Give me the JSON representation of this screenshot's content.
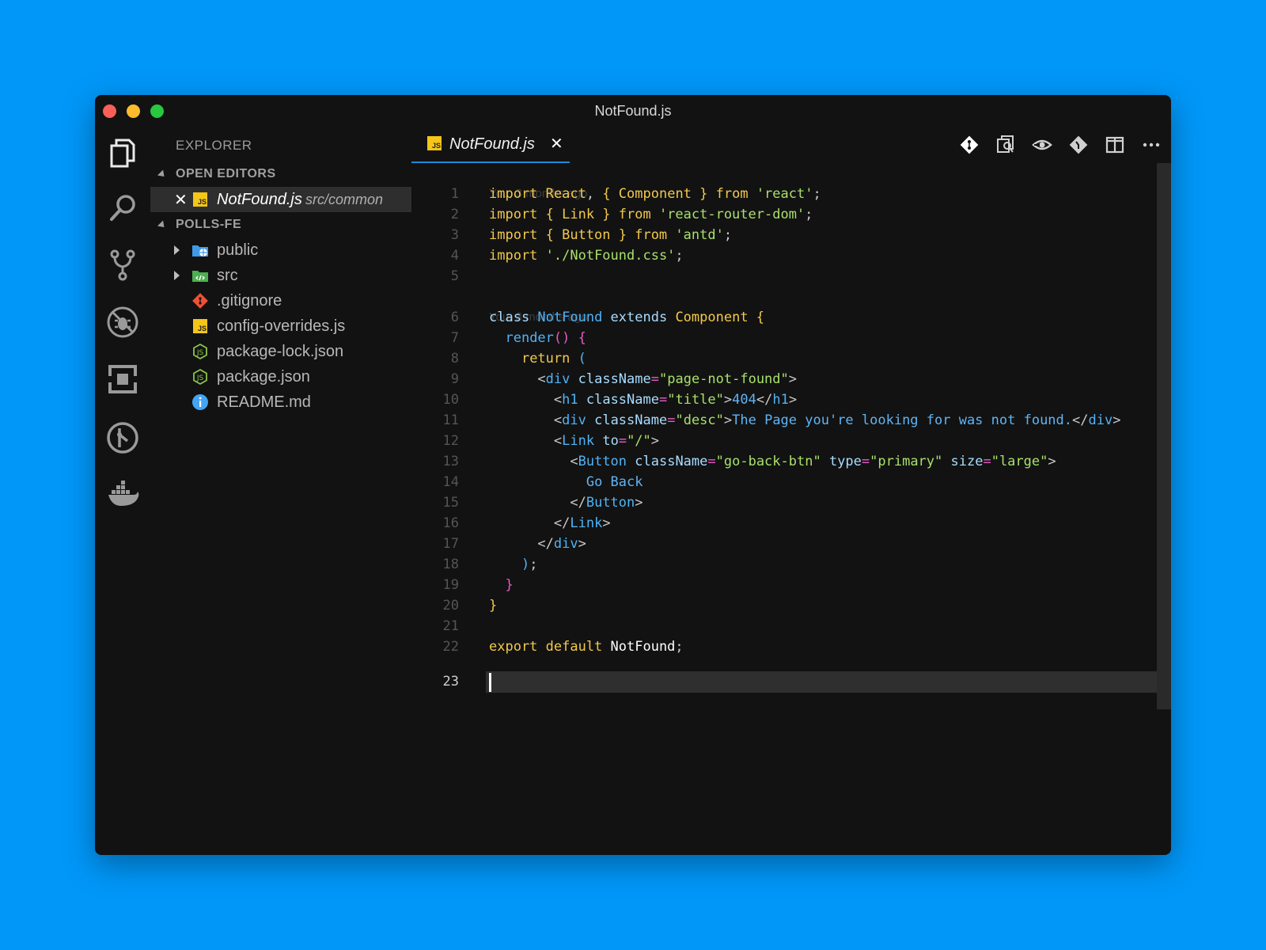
{
  "window": {
    "title": "NotFound.js"
  },
  "sidebar": {
    "title": "EXPLORER",
    "open_editors_label": "OPEN EDITORS",
    "open_editor": {
      "name": "NotFound.js",
      "path": "src/common",
      "close": "✕"
    },
    "project_label": "POLLS-FE",
    "tree": [
      {
        "name": "public",
        "icon": "folder-public-icon",
        "folder": true
      },
      {
        "name": "src",
        "icon": "folder-src-icon",
        "folder": true
      },
      {
        "name": ".gitignore",
        "icon": "git-icon",
        "folder": false
      },
      {
        "name": "config-overrides.js",
        "icon": "js-file-icon",
        "folder": false
      },
      {
        "name": "package-lock.json",
        "icon": "nodejs-icon",
        "folder": false
      },
      {
        "name": "package.json",
        "icon": "nodejs-icon",
        "folder": false
      },
      {
        "name": "README.md",
        "icon": "info-icon",
        "folder": false
      }
    ]
  },
  "tab": {
    "label": "NotFound.js",
    "close": "✕"
  },
  "editor": {
    "blame_1": "You, 3 months ago",
    "blame_2": "You, 3 months ago",
    "line_numbers": [
      "1",
      "2",
      "3",
      "4",
      "5",
      "6",
      "7",
      "8",
      "9",
      "10",
      "11",
      "12",
      "13",
      "14",
      "15",
      "16",
      "17",
      "18",
      "19",
      "20",
      "21",
      "22",
      "23"
    ],
    "lines": [
      "import React, { Component } from 'react';",
      "import { Link } from 'react-router-dom';",
      "import { Button } from 'antd';",
      "import './NotFound.css';",
      "",
      "class NotFound extends Component {",
      "  render() {",
      "    return (",
      "      <div className=\"page-not-found\">",
      "        <h1 className=\"title\">404</h1>",
      "        <div className=\"desc\">The Page you're looking for was not found.</div>",
      "        <Link to=\"/\">",
      "          <Button className=\"go-back-btn\" type=\"primary\" size=\"large\">",
      "            Go Back",
      "          </Button>",
      "        </Link>",
      "      </div>",
      "    );",
      "  }",
      "}",
      "",
      "export default NotFound;",
      ""
    ],
    "active_line": 23
  }
}
